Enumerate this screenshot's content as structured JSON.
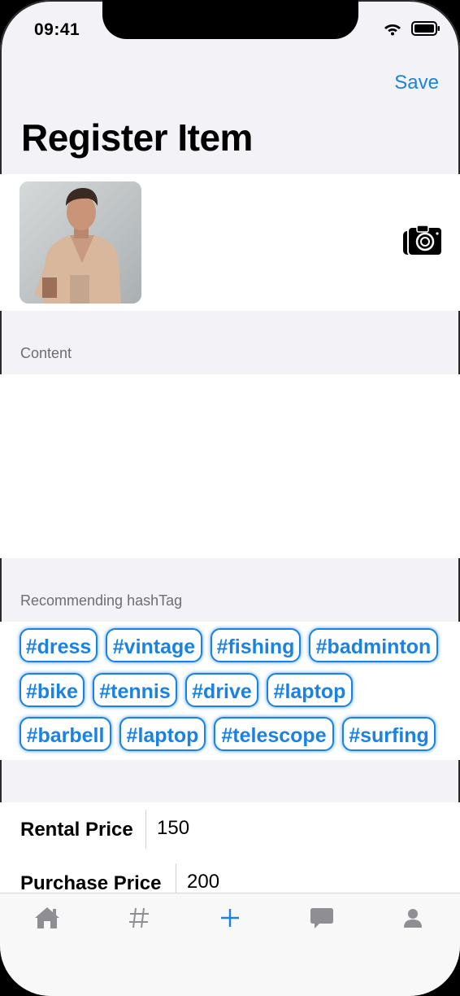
{
  "status_bar": {
    "time": "09:41"
  },
  "nav": {
    "save_label": "Save",
    "title": "Register Item"
  },
  "photo": {
    "camera_icon": "camera-icon"
  },
  "content_section": {
    "label": "Content",
    "value": ""
  },
  "hashtag_section": {
    "label": "Recommending hashTag",
    "tags": [
      "#dress",
      "#vintage",
      "#fishing",
      "#badminton",
      "#bike",
      "#tennis",
      "#drive",
      "#laptop",
      "#barbell",
      "#laptop",
      "#telescope",
      "#surfing"
    ]
  },
  "prices": {
    "rental_label": "Rental Price",
    "rental_value": "150",
    "purchase_label": "Purchase Price",
    "purchase_value": "200"
  },
  "tabbar": {
    "items": [
      {
        "icon": "home-icon",
        "active": false
      },
      {
        "icon": "hashtag-icon",
        "active": false
      },
      {
        "icon": "plus-icon",
        "active": true
      },
      {
        "icon": "chat-bubble-icon",
        "active": false
      },
      {
        "icon": "person-icon",
        "active": false
      }
    ]
  },
  "colors": {
    "accent": "#1a82e2",
    "inactive_tab": "#8e8e93",
    "background": "#f2f2f7"
  }
}
